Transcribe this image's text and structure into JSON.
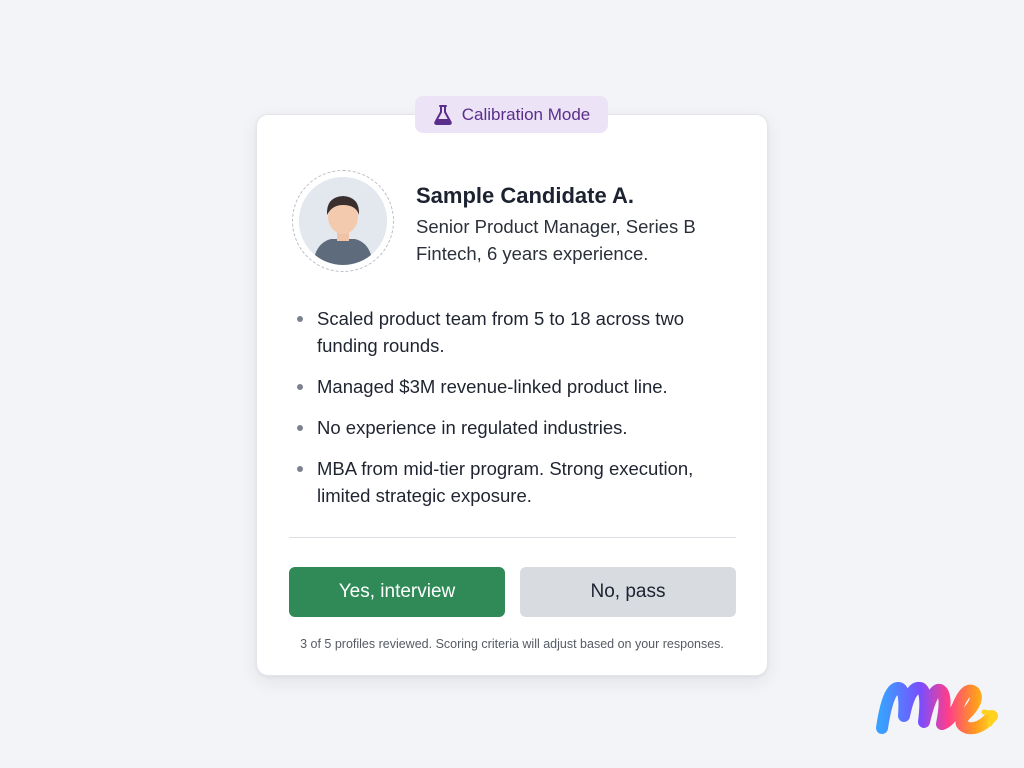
{
  "badge": {
    "label": "Calibration Mode",
    "icon": "flask-icon"
  },
  "candidate": {
    "name": "Sample Candidate A.",
    "title_line1": "Senior Product Manager, Series B",
    "title_line2": "Fintech, 6 years experience.",
    "avatar_icon": "person-avatar-icon"
  },
  "highlights": [
    {
      "line1": "Scaled product team from 5 to 18 across two",
      "line2": "funding rounds."
    },
    {
      "line1": "Managed $3M revenue-linked product line.",
      "line2": ""
    },
    {
      "line1": "No experience in regulated industries.",
      "line2": ""
    },
    {
      "line1": "MBA from mid-tier program. Strong execution,",
      "line2": "limited strategic exposure."
    }
  ],
  "actions": {
    "yes_label": "Yes, interview",
    "no_label": "No, pass"
  },
  "footer": {
    "status": "3 of 5 profiles reviewed. Scoring criteria will adjust based on your responses."
  },
  "colors": {
    "accent_green": "#2f8a58",
    "badge_bg": "#ece3f7",
    "badge_text": "#5b2e8c",
    "secondary_button": "#d8dbe0"
  }
}
